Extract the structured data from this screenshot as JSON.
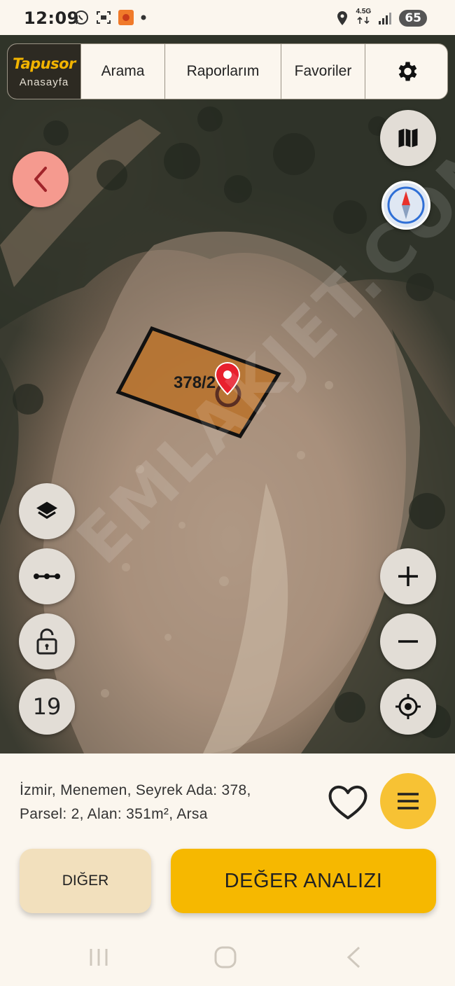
{
  "status_bar": {
    "time": "12:09",
    "network": "4.5G",
    "battery": "65"
  },
  "nav": {
    "brand_logo": "Tapusor",
    "brand_label": "Anasayfa",
    "tabs": [
      {
        "label": "Arama"
      },
      {
        "label": "Raporlarım"
      },
      {
        "label": "Favoriler"
      }
    ]
  },
  "map": {
    "parcel_label": "378/2",
    "zoom_level": "19",
    "watermark": "EMLAKJET.COM"
  },
  "parcel_info": {
    "line1": "İzmir, Menemen, Seyrek Ada: 378,",
    "line2": "Parsel: 2, Alan: 351m², Arsa"
  },
  "actions": {
    "other_label": "DIĞER",
    "value_analysis_label": "DEĞER ANALIZI"
  },
  "colors": {
    "accent": "#f6b800",
    "parcel_fill": "#b8732f",
    "pin": "#e8202e",
    "back_button": "#f59a8f"
  }
}
